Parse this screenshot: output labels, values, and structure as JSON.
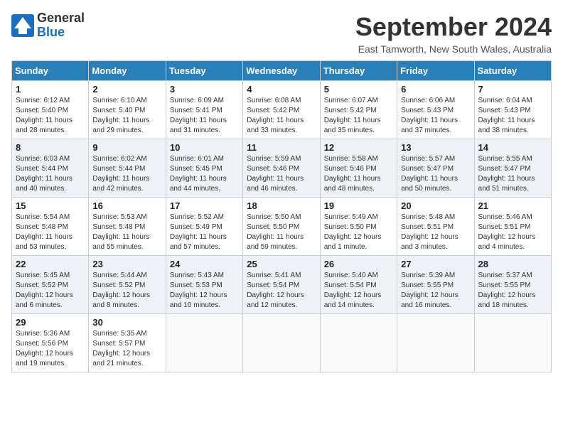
{
  "header": {
    "logo_general": "General",
    "logo_blue": "Blue",
    "month_title": "September 2024",
    "location": "East Tamworth, New South Wales, Australia"
  },
  "calendar": {
    "days_of_week": [
      "Sunday",
      "Monday",
      "Tuesday",
      "Wednesday",
      "Thursday",
      "Friday",
      "Saturday"
    ],
    "weeks": [
      [
        {
          "day": "",
          "info": ""
        },
        {
          "day": "2",
          "info": "Sunrise: 6:10 AM\nSunset: 5:40 PM\nDaylight: 11 hours\nand 29 minutes."
        },
        {
          "day": "3",
          "info": "Sunrise: 6:09 AM\nSunset: 5:41 PM\nDaylight: 11 hours\nand 31 minutes."
        },
        {
          "day": "4",
          "info": "Sunrise: 6:08 AM\nSunset: 5:42 PM\nDaylight: 11 hours\nand 33 minutes."
        },
        {
          "day": "5",
          "info": "Sunrise: 6:07 AM\nSunset: 5:42 PM\nDaylight: 11 hours\nand 35 minutes."
        },
        {
          "day": "6",
          "info": "Sunrise: 6:06 AM\nSunset: 5:43 PM\nDaylight: 11 hours\nand 37 minutes."
        },
        {
          "day": "7",
          "info": "Sunrise: 6:04 AM\nSunset: 5:43 PM\nDaylight: 11 hours\nand 38 minutes."
        }
      ],
      [
        {
          "day": "1",
          "info": "Sunrise: 6:12 AM\nSunset: 5:40 PM\nDaylight: 11 hours\nand 28 minutes."
        },
        {
          "day": "",
          "info": ""
        },
        {
          "day": "",
          "info": ""
        },
        {
          "day": "",
          "info": ""
        },
        {
          "day": "",
          "info": ""
        },
        {
          "day": "",
          "info": ""
        },
        {
          "day": "",
          "info": ""
        }
      ],
      [
        {
          "day": "8",
          "info": "Sunrise: 6:03 AM\nSunset: 5:44 PM\nDaylight: 11 hours\nand 40 minutes."
        },
        {
          "day": "9",
          "info": "Sunrise: 6:02 AM\nSunset: 5:44 PM\nDaylight: 11 hours\nand 42 minutes."
        },
        {
          "day": "10",
          "info": "Sunrise: 6:01 AM\nSunset: 5:45 PM\nDaylight: 11 hours\nand 44 minutes."
        },
        {
          "day": "11",
          "info": "Sunrise: 5:59 AM\nSunset: 5:46 PM\nDaylight: 11 hours\nand 46 minutes."
        },
        {
          "day": "12",
          "info": "Sunrise: 5:58 AM\nSunset: 5:46 PM\nDaylight: 11 hours\nand 48 minutes."
        },
        {
          "day": "13",
          "info": "Sunrise: 5:57 AM\nSunset: 5:47 PM\nDaylight: 11 hours\nand 50 minutes."
        },
        {
          "day": "14",
          "info": "Sunrise: 5:55 AM\nSunset: 5:47 PM\nDaylight: 11 hours\nand 51 minutes."
        }
      ],
      [
        {
          "day": "15",
          "info": "Sunrise: 5:54 AM\nSunset: 5:48 PM\nDaylight: 11 hours\nand 53 minutes."
        },
        {
          "day": "16",
          "info": "Sunrise: 5:53 AM\nSunset: 5:48 PM\nDaylight: 11 hours\nand 55 minutes."
        },
        {
          "day": "17",
          "info": "Sunrise: 5:52 AM\nSunset: 5:49 PM\nDaylight: 11 hours\nand 57 minutes."
        },
        {
          "day": "18",
          "info": "Sunrise: 5:50 AM\nSunset: 5:50 PM\nDaylight: 11 hours\nand 59 minutes."
        },
        {
          "day": "19",
          "info": "Sunrise: 5:49 AM\nSunset: 5:50 PM\nDaylight: 12 hours\nand 1 minute."
        },
        {
          "day": "20",
          "info": "Sunrise: 5:48 AM\nSunset: 5:51 PM\nDaylight: 12 hours\nand 3 minutes."
        },
        {
          "day": "21",
          "info": "Sunrise: 5:46 AM\nSunset: 5:51 PM\nDaylight: 12 hours\nand 4 minutes."
        }
      ],
      [
        {
          "day": "22",
          "info": "Sunrise: 5:45 AM\nSunset: 5:52 PM\nDaylight: 12 hours\nand 6 minutes."
        },
        {
          "day": "23",
          "info": "Sunrise: 5:44 AM\nSunset: 5:52 PM\nDaylight: 12 hours\nand 8 minutes."
        },
        {
          "day": "24",
          "info": "Sunrise: 5:43 AM\nSunset: 5:53 PM\nDaylight: 12 hours\nand 10 minutes."
        },
        {
          "day": "25",
          "info": "Sunrise: 5:41 AM\nSunset: 5:54 PM\nDaylight: 12 hours\nand 12 minutes."
        },
        {
          "day": "26",
          "info": "Sunrise: 5:40 AM\nSunset: 5:54 PM\nDaylight: 12 hours\nand 14 minutes."
        },
        {
          "day": "27",
          "info": "Sunrise: 5:39 AM\nSunset: 5:55 PM\nDaylight: 12 hours\nand 16 minutes."
        },
        {
          "day": "28",
          "info": "Sunrise: 5:37 AM\nSunset: 5:55 PM\nDaylight: 12 hours\nand 18 minutes."
        }
      ],
      [
        {
          "day": "29",
          "info": "Sunrise: 5:36 AM\nSunset: 5:56 PM\nDaylight: 12 hours\nand 19 minutes."
        },
        {
          "day": "30",
          "info": "Sunrise: 5:35 AM\nSunset: 5:57 PM\nDaylight: 12 hours\nand 21 minutes."
        },
        {
          "day": "",
          "info": ""
        },
        {
          "day": "",
          "info": ""
        },
        {
          "day": "",
          "info": ""
        },
        {
          "day": "",
          "info": ""
        },
        {
          "day": "",
          "info": ""
        }
      ]
    ]
  }
}
